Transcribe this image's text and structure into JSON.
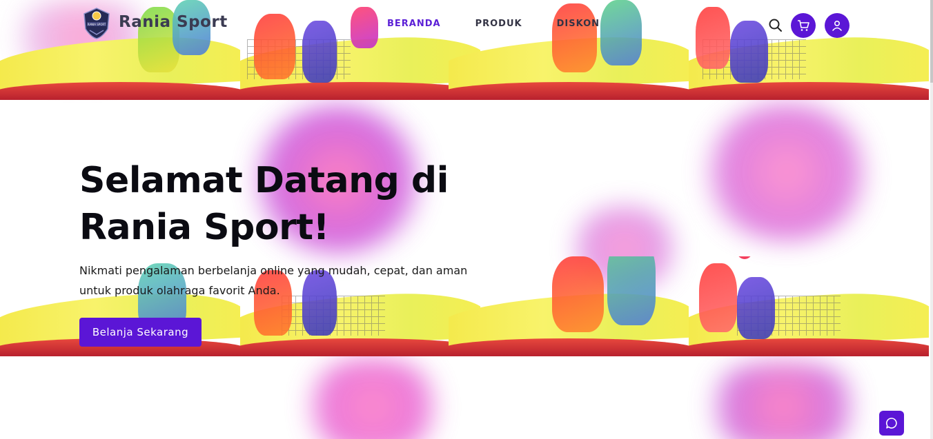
{
  "brand": {
    "name": "Rania Sport",
    "logo_text": "RANIA SPORT"
  },
  "nav": {
    "items": [
      {
        "label": "BERANDA",
        "active": true
      },
      {
        "label": "PRODUK",
        "active": false
      },
      {
        "label": "DISKON",
        "active": false
      }
    ]
  },
  "header_icons": [
    "search-icon",
    "cart-icon",
    "user-icon"
  ],
  "hero": {
    "title": "Selamat Datang di Rania Sport!",
    "subtitle": "Nikmati pengalaman berbelanja online yang mudah, cepat, dan aman untuk produk olahraga favorit Anda.",
    "cta_label": "Belanja Sekarang"
  },
  "chat_icon": "chat-icon",
  "colors": {
    "accent": "#5b16d6",
    "active_nav": "#5b1fd6",
    "text": "#0b0b12"
  }
}
